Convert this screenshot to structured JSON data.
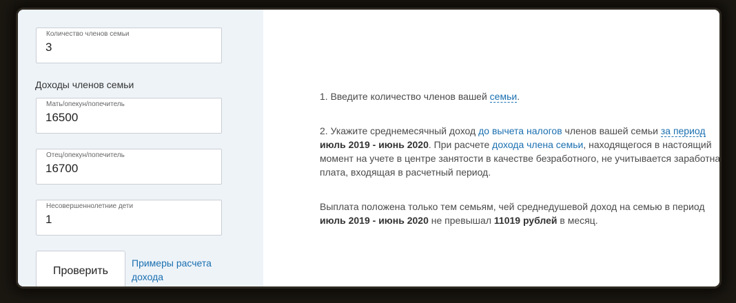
{
  "left": {
    "members_label": "Количество членов семьи",
    "members_value": "3",
    "incomes_title": "Доходы членов семьи",
    "mother_label": "Мать/опекун/попечитель",
    "mother_value": "16500",
    "father_label": "Отец/опекун/попечитель",
    "father_value": "16700",
    "children_label": "Несовершеннолетние дети",
    "children_value": "1",
    "check_button": "Проверить",
    "examples_link": "Примеры расчета дохода"
  },
  "right": {
    "p1_text": "1. Введите количество членов вашей ",
    "p1_link": "семьи",
    "p1_end": ".",
    "p2_a": "2. Укажите среднемесячный доход ",
    "p2_link1": "до вычета налогов",
    "p2_b": " членов вашей семьи ",
    "p2_link2": "за период",
    "p2_bold": "июль 2019 - июнь 2020",
    "p2_c": ". При расчете ",
    "p2_link3": "дохода члена семьи",
    "p2_d": ", находящегося в настоящий момент на учете в центре занятости в качестве безработного, не учитывается заработная плата, входящая в расчетный период.",
    "p3_a": "Выплата положена только тем семьям, чей среднедушевой доход на семью в период",
    "p3_bold1": "июль 2019 - июнь 2020",
    "p3_b": " не превышал ",
    "p3_bold2": "11019 рублей",
    "p3_c": " в месяц."
  }
}
